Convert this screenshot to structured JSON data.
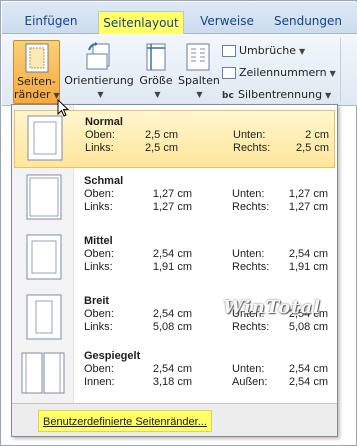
{
  "tabs": [
    {
      "label": "Einfügen",
      "active": false
    },
    {
      "label": "Seitenlayout",
      "active": true
    },
    {
      "label": "Verweise",
      "active": false
    },
    {
      "label": "Sendungen",
      "active": false
    }
  ],
  "ribbon": {
    "margins": {
      "line1": "Seiten-",
      "line2": "ränder"
    },
    "orientation": "Orientierung",
    "size": "Größe",
    "columns": "Spalten",
    "breaks": "Umbrüche",
    "line_numbers": "Zeilennummern",
    "hyphenation": "Silbentrennung",
    "hyphenation_prefix": "bc"
  },
  "margin_presets": [
    {
      "name": "Normal",
      "row1": {
        "l1": "Oben:",
        "v1": "2,5 cm",
        "l2": "Unten:",
        "v2": "2 cm"
      },
      "row2": {
        "l1": "Links:",
        "v1": "2,5 cm",
        "l2": "Rechts:",
        "v2": "2,5 cm"
      }
    },
    {
      "name": "Schmal",
      "row1": {
        "l1": "Oben:",
        "v1": "1,27 cm",
        "l2": "Unten:",
        "v2": "1,27 cm"
      },
      "row2": {
        "l1": "Links:",
        "v1": "1,27 cm",
        "l2": "Rechts:",
        "v2": "1,27 cm"
      }
    },
    {
      "name": "Mittel",
      "row1": {
        "l1": "Oben:",
        "v1": "2,54 cm",
        "l2": "Unten:",
        "v2": "2,54 cm"
      },
      "row2": {
        "l1": "Links:",
        "v1": "1,91 cm",
        "l2": "Rechts:",
        "v2": "1,91 cm"
      }
    },
    {
      "name": "Breit",
      "row1": {
        "l1": "Oben:",
        "v1": "2,54 cm",
        "l2": "Unten:",
        "v2": "2,54 cm"
      },
      "row2": {
        "l1": "Links:",
        "v1": "5,08 cm",
        "l2": "Rechts:",
        "v2": "5,08 cm"
      }
    },
    {
      "name": "Gespiegelt",
      "row1": {
        "l1": "Oben:",
        "v1": "2,54 cm",
        "l2": "Unten:",
        "v2": "2,54 cm"
      },
      "row2": {
        "l1": "Innen:",
        "v1": "3,18 cm",
        "l2": "Außen:",
        "v2": "2,54 cm"
      }
    }
  ],
  "footer": {
    "custom_margins": "Benutzerdefinierte Seitenränder..."
  },
  "watermark": "WinTotal",
  "colors": {
    "highlight": "#ffff66",
    "pressed": "#f6a83f",
    "selected_item": "#ffe69a"
  }
}
